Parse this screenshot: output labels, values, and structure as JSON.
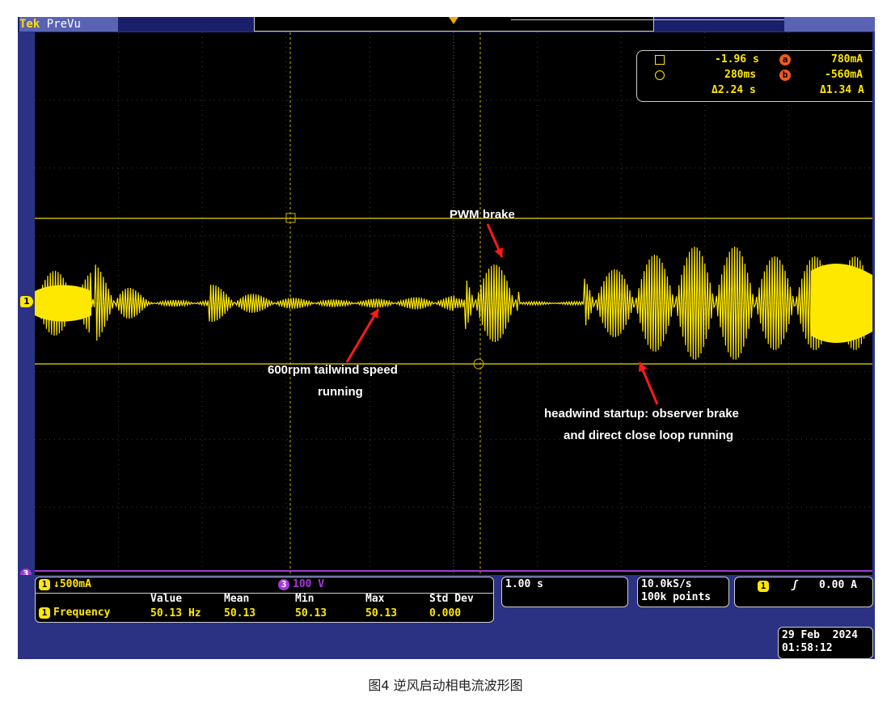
{
  "header": {
    "brand": "Tek",
    "mode": "PreVu"
  },
  "cursor_readout": {
    "t1": "-1.96 s",
    "t2": "280ms",
    "dt": "Δ2.24 s",
    "a_marker": "a",
    "b_marker": "b",
    "a_val": "780mA",
    "b_val": "-560mA",
    "d_amp": "Δ1.34 A"
  },
  "channel_markers": {
    "ch1": "1",
    "a": "a",
    "b": "b",
    "ch3": "3"
  },
  "annotations": {
    "pwm": "PWM brake",
    "tail_line1": "600rpm tailwind speed",
    "tail_line2": "running",
    "head_line1": "headwind startup: observer brake",
    "head_line2": "and direct close loop running"
  },
  "bottom": {
    "ch1_chip": "1",
    "ch1_scale": "↓500mA",
    "ch3_chip": "3",
    "ch3_scale": "100 V",
    "meas_headers": [
      "Value",
      "Mean",
      "Min",
      "Max",
      "Std Dev"
    ],
    "meas_label": "Frequency",
    "meas_values": [
      "50.13 Hz",
      "50.13",
      "50.13",
      "50.13",
      "0.000"
    ],
    "timebase": "1.00 s",
    "sample_rate": "10.0kS/s",
    "record_length": "100k points",
    "trig_chip": "1",
    "trig_slope": "ʃ",
    "trig_level": "0.00 A",
    "date": "29 Feb  2024",
    "time": "01:58:12"
  },
  "caption": "图4 逆风启动相电流波形图",
  "colors": {
    "trace": "#ffe800",
    "cursor": "#c8b400",
    "annot_arrow": "#ff1a1a",
    "bezel": "#2b3183",
    "marker_orange": "#f05a1c",
    "ch3_purple": "#a23ad6"
  }
}
